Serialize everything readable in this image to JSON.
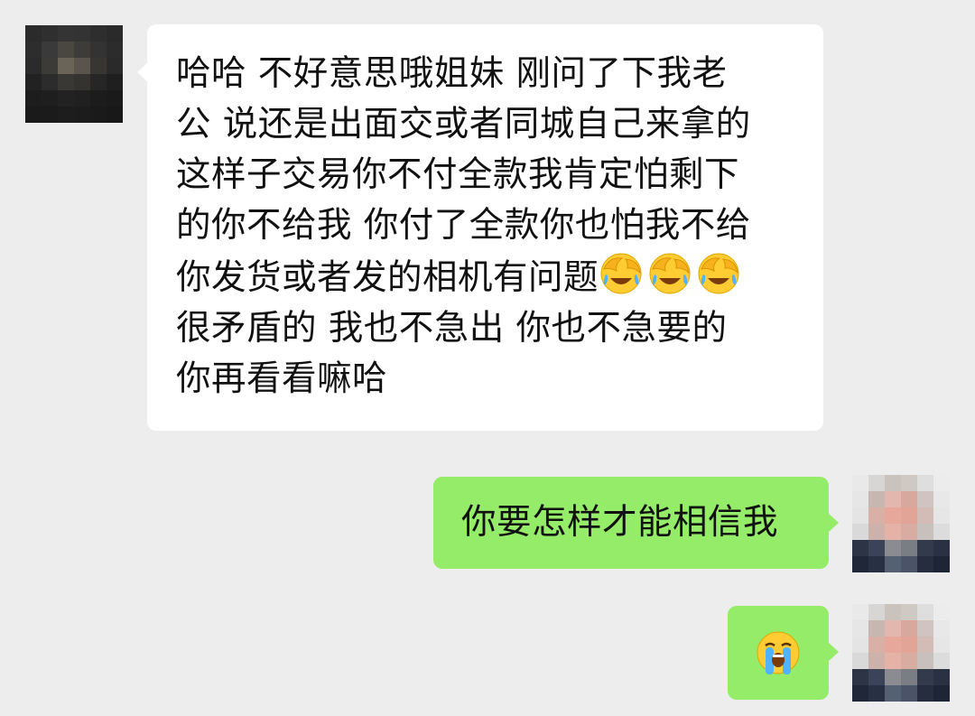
{
  "chat": {
    "colors": {
      "background": "#ededed",
      "incoming_bubble": "#ffffff",
      "outgoing_bubble": "#95ec69"
    },
    "messages": [
      {
        "id": "m1",
        "direction": "incoming",
        "avatar": "contact-avatar (pixelated)",
        "lines": [
          "哈哈 不好意思哦姐妹 刚问了下我老",
          "公 说还是出面交或者同城自己来拿的",
          "这样子交易你不付全款我肯定怕剩下",
          "的你不给我 你付了全款你也怕我不给",
          "你发货或者发的相机有问题",
          "很矛盾的 我也不急出 你也不急要的",
          "你再看看嘛哈"
        ],
        "inline_emojis": [
          "facepalm-laugh-cry",
          "facepalm-laugh-cry",
          "facepalm-laugh-cry"
        ]
      },
      {
        "id": "m2",
        "direction": "outgoing",
        "avatar": "self-avatar (pixelated)",
        "text": "你要怎样才能相信我"
      },
      {
        "id": "m3",
        "direction": "outgoing",
        "avatar": "self-avatar (pixelated)",
        "emoji": "loudly-crying-face"
      }
    ]
  }
}
